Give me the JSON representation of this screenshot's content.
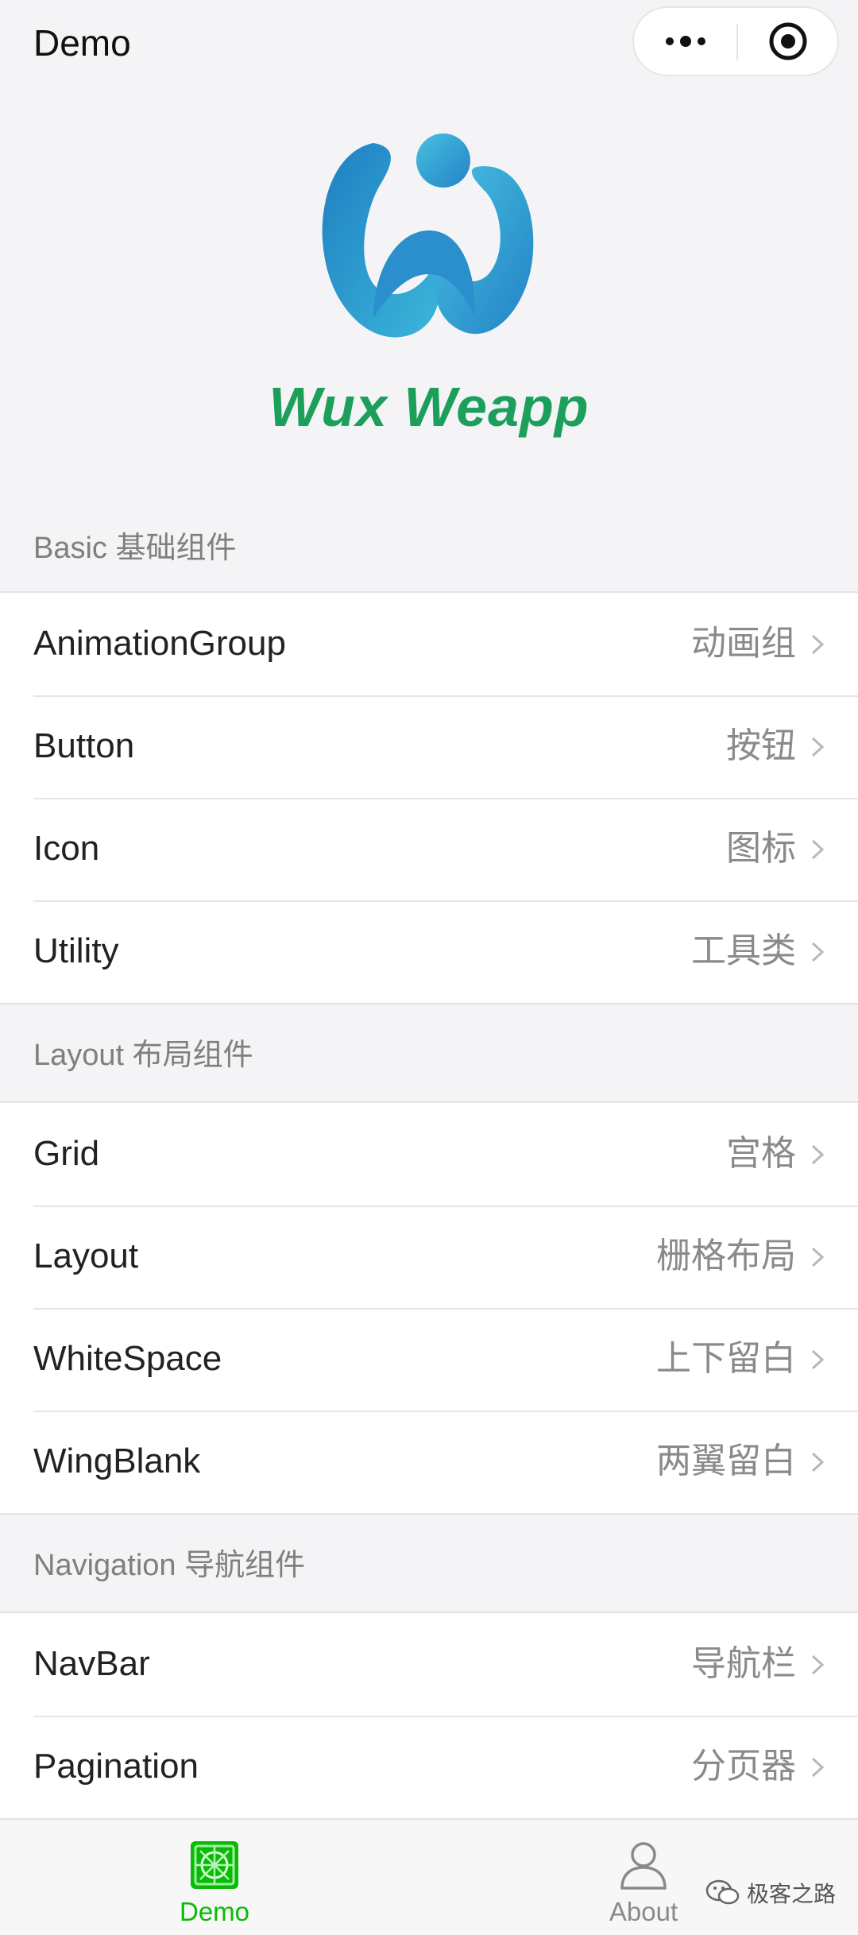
{
  "header": {
    "title": "Demo",
    "more_icon": "more-dots-icon",
    "close_icon": "target-close-icon"
  },
  "brand": {
    "name": "Wux Weapp",
    "color": "#1d9f5c",
    "logo_color": "#2a8fcf"
  },
  "sections": [
    {
      "header": "Basic 基础组件",
      "items": [
        {
          "label": "AnimationGroup",
          "desc": "动画组"
        },
        {
          "label": "Button",
          "desc": "按钮"
        },
        {
          "label": "Icon",
          "desc": "图标"
        },
        {
          "label": "Utility",
          "desc": "工具类"
        }
      ]
    },
    {
      "header": "Layout 布局组件",
      "items": [
        {
          "label": "Grid",
          "desc": "宫格"
        },
        {
          "label": "Layout",
          "desc": "栅格布局"
        },
        {
          "label": "WhiteSpace",
          "desc": "上下留白"
        },
        {
          "label": "WingBlank",
          "desc": "两翼留白"
        }
      ]
    },
    {
      "header": "Navigation 导航组件",
      "items": [
        {
          "label": "NavBar",
          "desc": "导航栏"
        },
        {
          "label": "Pagination",
          "desc": "分页器"
        }
      ]
    }
  ],
  "tabbar": {
    "tabs": [
      {
        "label": "Demo",
        "icon": "demo-grid-icon",
        "active": true,
        "color": "#09bb07"
      },
      {
        "label": "About",
        "icon": "user-icon",
        "active": false,
        "color": "#8a8a8a"
      }
    ]
  },
  "watermark": {
    "text": "极客之路",
    "icon": "wechat-icon"
  }
}
